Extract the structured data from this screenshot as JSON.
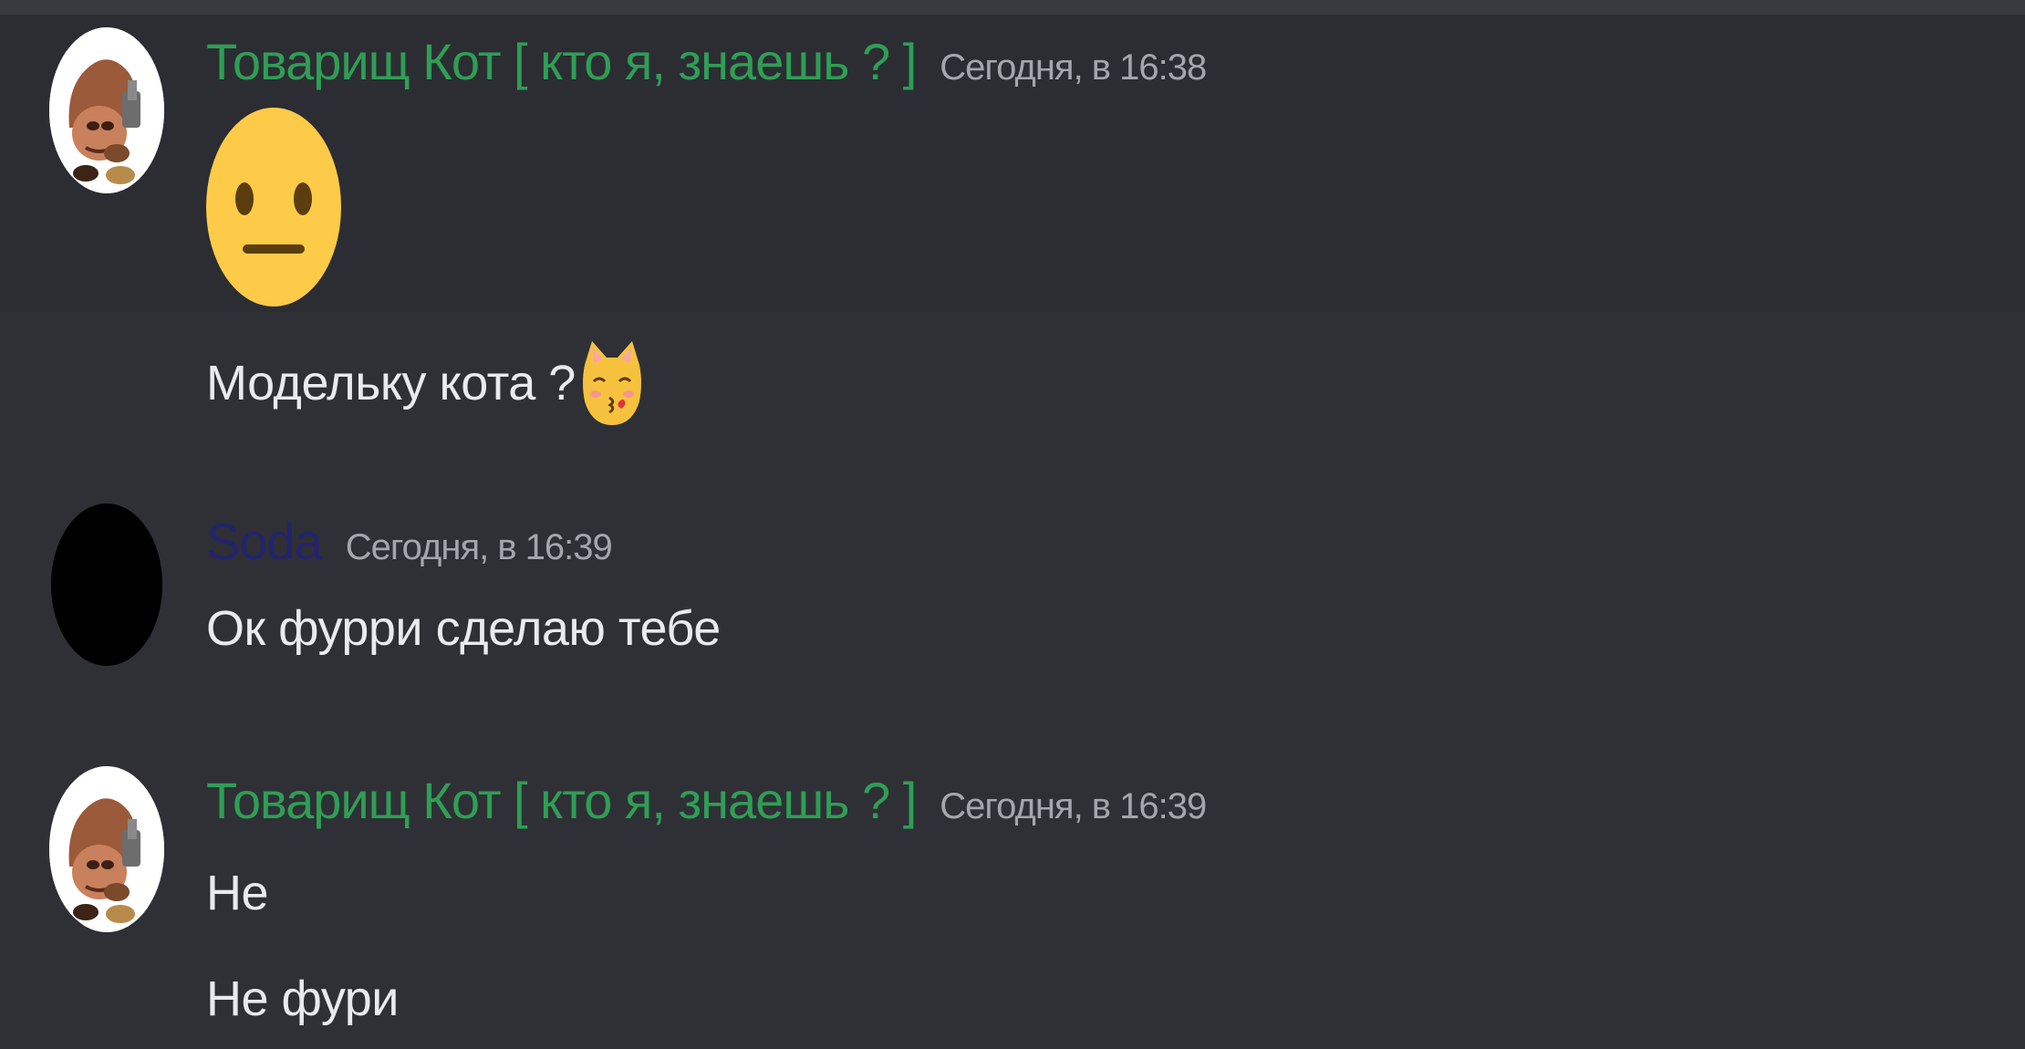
{
  "colors": {
    "background": "#2f3036",
    "username_green": "#2f9e55",
    "username_navy": "#25236c",
    "timestamp": "#a3a6ad",
    "message_text": "#e9eaee"
  },
  "messages": [
    {
      "author": "Товарищ Кот [ кто я, знаешь ? ]",
      "timestamp": "Сегодня, в 16:38",
      "avatar": "goomba-avatar",
      "lines": [
        {
          "emoji": "neutral-face-emoji"
        },
        {
          "text": "Модельку кота ?",
          "emoji": "kissing-cat-emoji"
        }
      ]
    },
    {
      "author": "Soda",
      "timestamp": "Сегодня, в 16:39",
      "avatar": "black-circle-avatar",
      "lines": [
        {
          "text": "Ок фурри сделаю тебе"
        }
      ]
    },
    {
      "author": "Товарищ Кот [ кто я, знаешь ? ]",
      "timestamp": "Сегодня, в 16:39",
      "avatar": "goomba-avatar",
      "lines": [
        {
          "text": "Не"
        },
        {
          "text": "Не фури"
        }
      ]
    }
  ]
}
